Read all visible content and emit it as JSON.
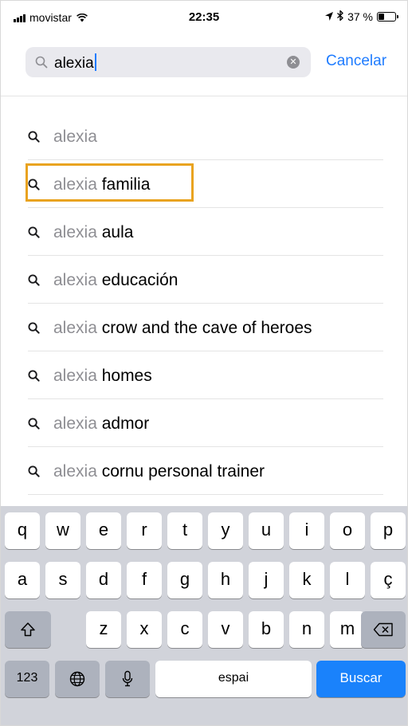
{
  "status_bar": {
    "carrier": "movistar",
    "time": "22:35",
    "battery_text": "37 %",
    "battery_level": 0.37
  },
  "search": {
    "query": "alexia",
    "cancel_label": "Cancelar"
  },
  "suggestions": [
    {
      "prefix": "alexia",
      "completion": ""
    },
    {
      "prefix": "alexia",
      "completion": " familia"
    },
    {
      "prefix": "alexia",
      "completion": " aula"
    },
    {
      "prefix": "alexia",
      "completion": " educación"
    },
    {
      "prefix": "alexia",
      "completion": " crow and the cave of heroes"
    },
    {
      "prefix": "alexia",
      "completion": " homes"
    },
    {
      "prefix": "alexia",
      "completion": " admor"
    },
    {
      "prefix": "alexia",
      "completion": " cornu personal trainer"
    }
  ],
  "highlighted_suggestion_index": 1,
  "keyboard": {
    "row1": [
      "q",
      "w",
      "e",
      "r",
      "t",
      "y",
      "u",
      "i",
      "o",
      "p"
    ],
    "row2": [
      "a",
      "s",
      "d",
      "f",
      "g",
      "h",
      "j",
      "k",
      "l",
      "ç"
    ],
    "row3": [
      "z",
      "x",
      "c",
      "v",
      "b",
      "n",
      "m"
    ],
    "numbers_label": "123",
    "space_label": "espai",
    "return_label": "Buscar"
  },
  "colors": {
    "accent": "#1f7cff",
    "highlight": "#e9a320",
    "keyboard_bg": "#d1d3da",
    "return_key": "#1a82fb"
  },
  "icons": [
    "signal-icon",
    "wifi-icon",
    "location-icon",
    "bluetooth-icon",
    "battery-icon",
    "search-icon",
    "clear-icon",
    "shift-icon",
    "backspace-icon",
    "globe-icon",
    "microphone-icon"
  ]
}
